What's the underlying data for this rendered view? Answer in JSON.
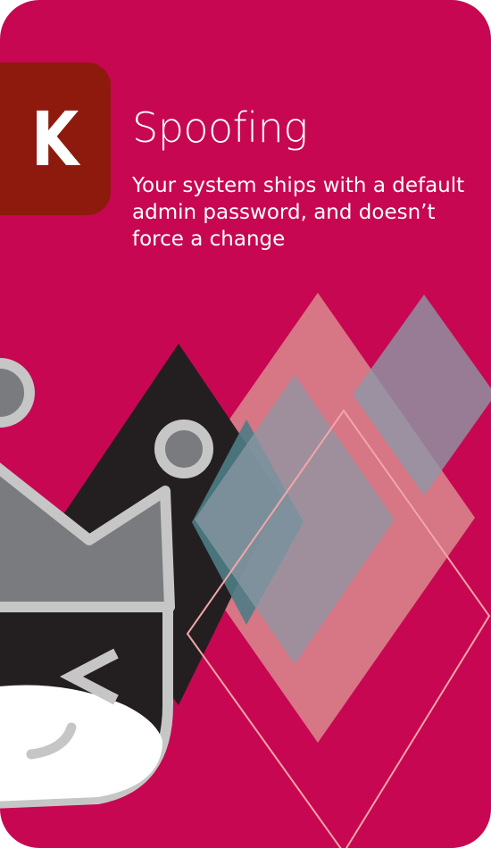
{
  "card": {
    "rank": "K",
    "title": "Spoofing",
    "description": "Your system ships with a default admin password, and doesn’t force a change"
  },
  "colors": {
    "card_background": "#c70751",
    "rank_badge": "#8e1a0e",
    "text": "#ffffff",
    "dark_shape": "#231f20",
    "grey_shape": "#7a7b7f",
    "outline_grey": "#c6c6c6",
    "salmon_diamond": "#d98a8e",
    "teal_diamond": "#4e7d86",
    "slate_diamond": "#8c98a6",
    "line_pink": "#f2a6a8"
  },
  "icons": [
    "robot-face-illustration",
    "diamond-pattern"
  ]
}
